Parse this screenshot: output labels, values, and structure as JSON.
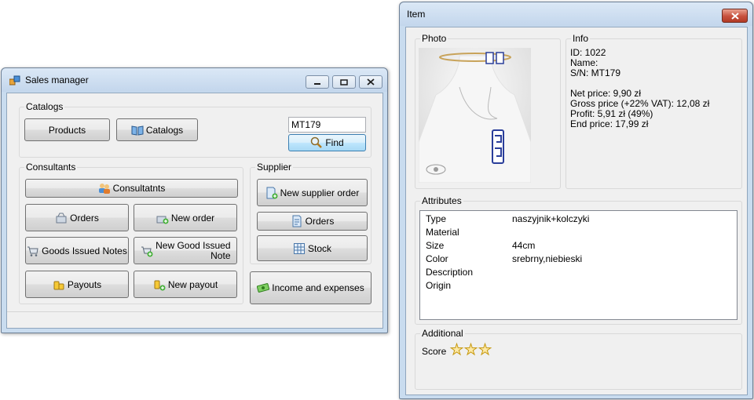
{
  "sales_window": {
    "title": "Sales manager",
    "catalogs": {
      "group_label": "Catalogs",
      "products_label": "Products",
      "catalogs_label": "Catalogs",
      "search_value": "MT179",
      "find_label": "Find"
    },
    "consultants": {
      "group_label": "Consultants",
      "consultants_label": "Consultatnts",
      "orders_label": "Orders",
      "new_order_label": "New order",
      "goods_issued_notes_label": "Goods Issued Notes",
      "new_good_issued_note_label": "New Good Issued Note",
      "payouts_label": "Payouts",
      "new_payout_label": "New payout"
    },
    "supplier": {
      "group_label": "Supplier",
      "new_supplier_order_label": "New supplier order",
      "orders_label": "Orders",
      "stock_label": "Stock"
    },
    "income_expenses_label": "Income and expenses"
  },
  "item_window": {
    "title": "Item",
    "photo_label": "Photo",
    "info": {
      "group_label": "Info",
      "id": "ID: 1022",
      "name": "Name:",
      "sn": "S/N: MT179",
      "net_price": "Net price: 9,90 zł",
      "gross_price": "Gross price (+22% VAT): 12,08 zł",
      "profit": "Profit: 5,91 zł (49%)",
      "end_price": "End price: 17,99 zł"
    },
    "attributes": {
      "group_label": "Attributes",
      "rows": [
        {
          "name": "Type",
          "value": "naszyjnik+kolczyki"
        },
        {
          "name": "Material",
          "value": ""
        },
        {
          "name": "Size",
          "value": "44cm"
        },
        {
          "name": "Color",
          "value": "srebrny,niebieski"
        },
        {
          "name": "Description",
          "value": ""
        },
        {
          "name": "Origin",
          "value": ""
        }
      ]
    },
    "additional": {
      "group_label": "Additional",
      "score_label": "Score",
      "score_max": 3
    }
  },
  "colors": {
    "window_frame": "#c9dcef",
    "client_background": "#f0f0f0",
    "close_button": "#c7503d",
    "star_fill": "#fde9a7"
  }
}
